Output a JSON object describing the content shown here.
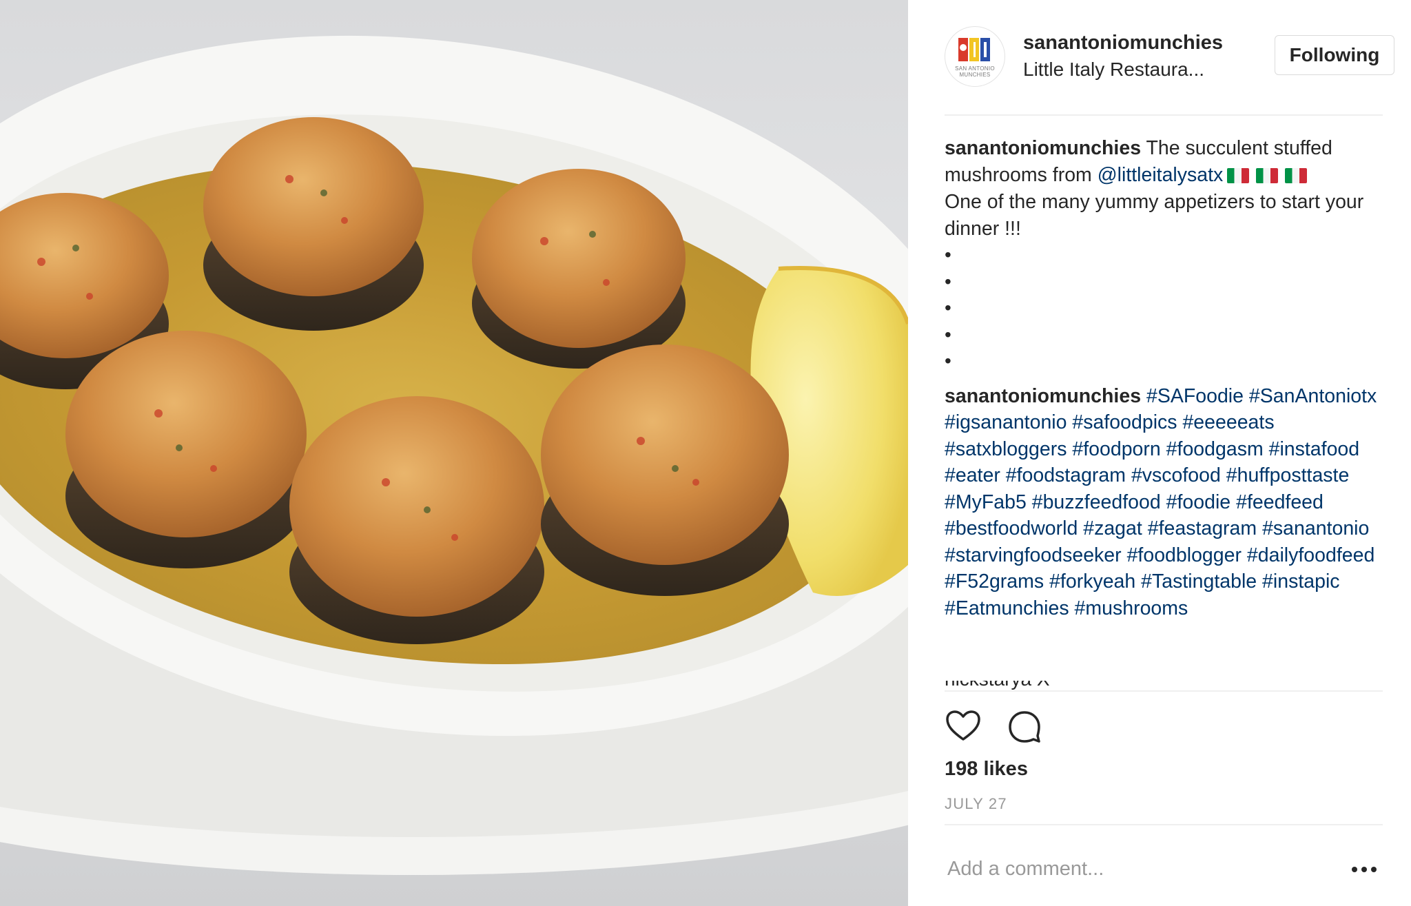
{
  "post": {
    "author": {
      "username": "sanantoniomunchies",
      "avatar_text": "SAN ANTONIO\nMUNCHIES"
    },
    "location": "Little Italy Restaura...",
    "follow_label": "Following",
    "caption": {
      "username": "sanantoniomunchies",
      "text_1": "The succulent stuffed mushrooms from ",
      "mention": "@littleitalysatx",
      "flags": [
        "italy-flag-icon",
        "italy-flag-icon",
        "italy-flag-icon"
      ],
      "text_2": "One of the many yummy appetizers to start your dinner !!!",
      "bullets": [
        "",
        "",
        "",
        "",
        ""
      ]
    },
    "hashtag_comment": {
      "username": "sanantoniomunchies",
      "hashtags": [
        "#SAFoodie",
        "#SanAntoniotx",
        "#igsanantonio",
        "#safoodpics",
        "#eeeeeats",
        "#satxbloggers",
        "#foodporn",
        "#foodgasm",
        "#instafood",
        "#eater",
        "#foodstagram",
        "#vscofood",
        "#huffposttaste",
        "#MyFab5",
        "#buzzfeedfood",
        "#foodie",
        "#feedfeed",
        "#bestfoodworld",
        "#zagat",
        "#feastagram",
        "#sanantonio",
        "#starvingfoodseeker",
        "#foodblogger",
        "#dailyfoodfeed",
        "#F52grams",
        "#forkyeah",
        "#Tastingtable",
        "#instapic",
        "#Eatmunchies",
        "#mushrooms"
      ]
    },
    "cutoff_comment": "nickstarya X",
    "actions": {
      "like_icon": "heart-icon",
      "comment_icon": "comment-bubble-icon"
    },
    "likes": "198 likes",
    "date": "JULY 27",
    "comment_placeholder": "Add a comment...",
    "more_icon": "more-options-icon"
  },
  "colors": {
    "text": "#262626",
    "link": "#003569",
    "muted": "#999999",
    "divider": "#efefef"
  }
}
